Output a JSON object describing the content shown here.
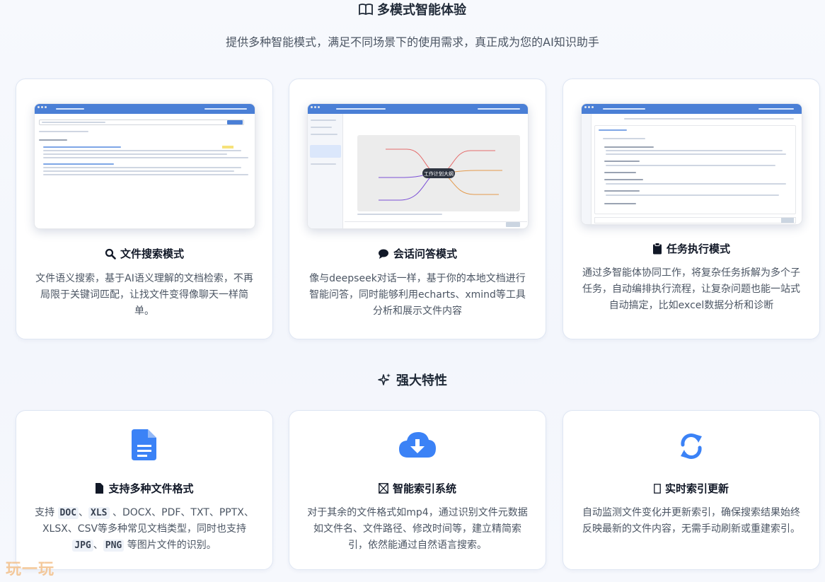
{
  "modes": {
    "title": "多模式智能体验",
    "subtitle": "提供多种智能模式，满足不同场景下的使用需求，真正成为您的AI知识助手",
    "cards": [
      {
        "title": "文件搜索模式",
        "desc": "文件语义搜索，基于AI语义理解的文档检索，不再局限于关键词匹配，让找文件变得像聊天一样简单。",
        "icon": "search-icon"
      },
      {
        "title": "会话问答模式",
        "desc": "像与deepseek对话一样，基于你的本地文档进行智能问答，同时能够利用echarts、xmind等工具分析和展示文件内容",
        "icon": "chat-bubble-icon"
      },
      {
        "title": "任务执行模式",
        "desc": "通过多智能体协同工作，将复杂任务拆解为多个子任务，自动编排执行流程，让复杂问题也能一站式自动搞定，比如excel数据分析和诊断",
        "icon": "clipboard-icon"
      }
    ],
    "mindmap_center": "工作计划大纲"
  },
  "features": {
    "title": "强大特性",
    "cards": [
      {
        "title": "支持多种文件格式",
        "desc_pre": "支持 ",
        "tag1": "DOC",
        "sep1": "、",
        "tag2": "XLS",
        "desc_mid": " 、DOCX、PDF、TXT、PPTX、XLSX、CSV等多种常见文档类型，同时也支持 ",
        "tag3": "JPG",
        "sep2": "、",
        "tag4": "PNG",
        "desc_post": " 等图片文件的识别。",
        "icon": "document-icon"
      },
      {
        "title": "智能索引系统",
        "desc": "对于其余的文件格式如mp4，通过识别文件元数据如文件名、文件路径、修改时间等，建立精简索引，依然能通过自然语言搜索。",
        "icon": "cloud-download-icon"
      },
      {
        "title": "实时索引更新",
        "desc": "自动监测文件变化并更新索引，确保搜索结果始终反映最新的文件内容，无需手动刷新或重建索引。",
        "icon": "refresh-icon"
      }
    ]
  },
  "watermark": "玩一玩",
  "colors": {
    "accent": "#4a7fd6",
    "icon_blue": "#3b82f6",
    "card_border": "#dfe6f3"
  }
}
